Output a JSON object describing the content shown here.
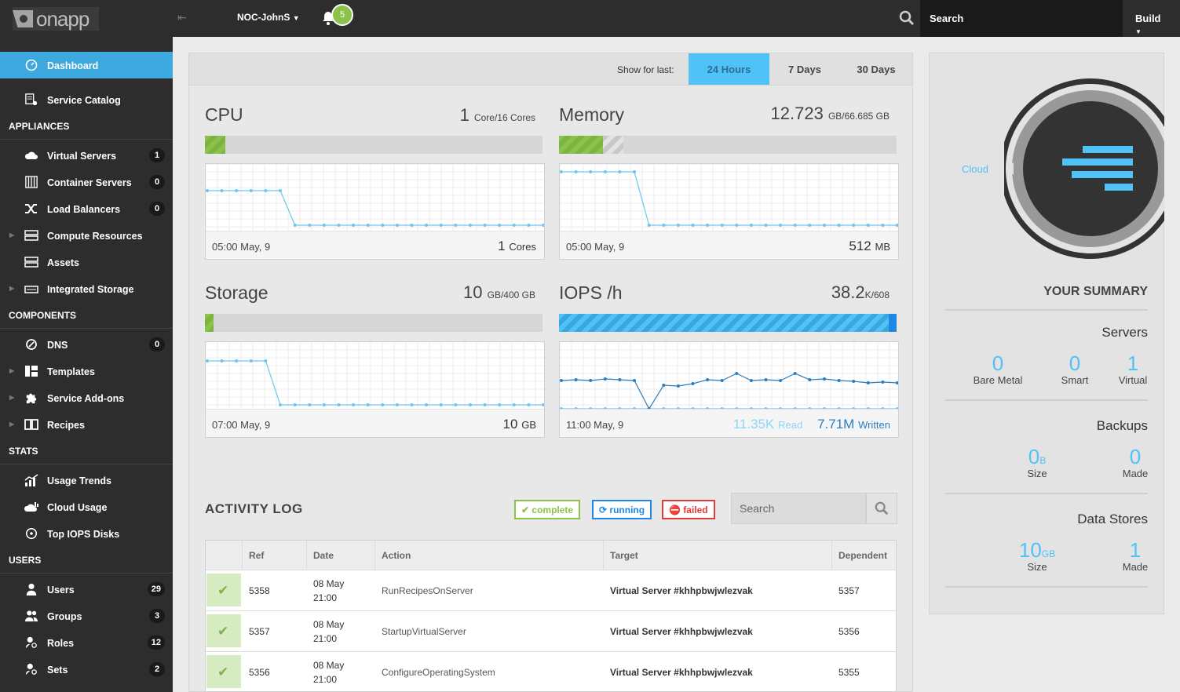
{
  "topbar": {
    "logo": "onapp",
    "user": "NOC-JohnS",
    "notifications": "5",
    "search": "Search",
    "build": "Build"
  },
  "sidebar": {
    "dashboard": "Dashboard",
    "service_catalog": "Service Catalog",
    "appliances_head": "APPLIANCES",
    "virtual_servers": "Virtual Servers",
    "virtual_servers_count": "1",
    "container_servers": "Container Servers",
    "container_servers_count": "0",
    "load_balancers": "Load Balancers",
    "load_balancers_count": "0",
    "compute_resources": "Compute Resources",
    "assets": "Assets",
    "integrated_storage": "Integrated Storage",
    "components_head": "COMPONENTS",
    "dns": "DNS",
    "dns_count": "0",
    "templates": "Templates",
    "service_addons": "Service Add-ons",
    "recipes": "Recipes",
    "stats_head": "STATS",
    "usage_trends": "Usage Trends",
    "cloud_usage": "Cloud Usage",
    "top_iops": "Top IOPS Disks",
    "users_head": "USERS",
    "users": "Users",
    "users_count": "29",
    "groups": "Groups",
    "groups_count": "3",
    "roles": "Roles",
    "roles_count": "12",
    "sets": "Sets",
    "sets_count": "2"
  },
  "period": {
    "label": "Show for last:",
    "tabs": [
      "24 Hours",
      "7 Days",
      "30 Days"
    ],
    "selected": "24 Hours"
  },
  "widgets": {
    "cpu": {
      "title": "CPU",
      "value": "1",
      "unit": "Core/16 Cores",
      "usage": 0.06,
      "time": "05:00 May, 9",
      "cur": "1",
      "cur_unit": "Cores"
    },
    "memory": {
      "title": "Memory",
      "value": "12.723",
      "unit": "GB/66.685 GB",
      "usage": 0.13,
      "time": "05:00 May, 9",
      "cur": "512",
      "cur_unit": "MB"
    },
    "storage": {
      "title": "Storage",
      "value": "10",
      "unit": "GB/400 GB",
      "usage": 0.025,
      "time": "07:00 May, 9",
      "cur": "10",
      "cur_unit": "GB"
    },
    "iops": {
      "title": "IOPS /h",
      "value": "38.2",
      "unit": "K/608",
      "usage": 0.98,
      "time": "11:00 May, 9",
      "read": "11.35K",
      "read_label": "Read",
      "written": "7.71M",
      "written_label": "Written"
    }
  },
  "activity": {
    "title": "ACTIVITY LOG",
    "filters": {
      "complete": "complete",
      "running": "running",
      "failed": "failed"
    },
    "search_placeholder": "Search",
    "columns": [
      "Ref",
      "Date",
      "Action",
      "Target",
      "Dependent"
    ],
    "rows": [
      {
        "ref": "5358",
        "date1": "08 May",
        "date2": "21:00",
        "action": "RunRecipesOnServer",
        "target": "Virtual Server #khhpbwjwlezvak",
        "dependent": "5357"
      },
      {
        "ref": "5357",
        "date1": "08 May",
        "date2": "21:00",
        "action": "StartupVirtualServer",
        "target": "Virtual Server #khhpbwjwlezvak",
        "dependent": "5356"
      },
      {
        "ref": "5356",
        "date1": "08 May",
        "date2": "21:00",
        "action": "ConfigureOperatingSystem",
        "target": "Virtual Server #khhpbwjwlezvak",
        "dependent": "5355"
      }
    ]
  },
  "summary": {
    "cloud": "Cloud",
    "title": "YOUR SUMMARY",
    "servers": {
      "title": "Servers",
      "bare_metal": "0",
      "bare_metal_label": "Bare Metal",
      "smart": "0",
      "smart_label": "Smart",
      "virtual": "1",
      "virtual_label": "Virtual"
    },
    "backups": {
      "title": "Backups",
      "size": "0",
      "size_unit": "B",
      "size_label": "Size",
      "made": "0",
      "made_label": "Made"
    },
    "data_stores": {
      "title": "Data Stores",
      "size": "10",
      "size_unit": "GB",
      "size_label": "Size",
      "made": "1",
      "made_label": "Made"
    }
  },
  "colors": {
    "accent": "#4fc3f7",
    "sidebar": "#2d2d2d",
    "green": "#8bc34a",
    "red": "#e53935",
    "blue": "#1e88e5"
  }
}
